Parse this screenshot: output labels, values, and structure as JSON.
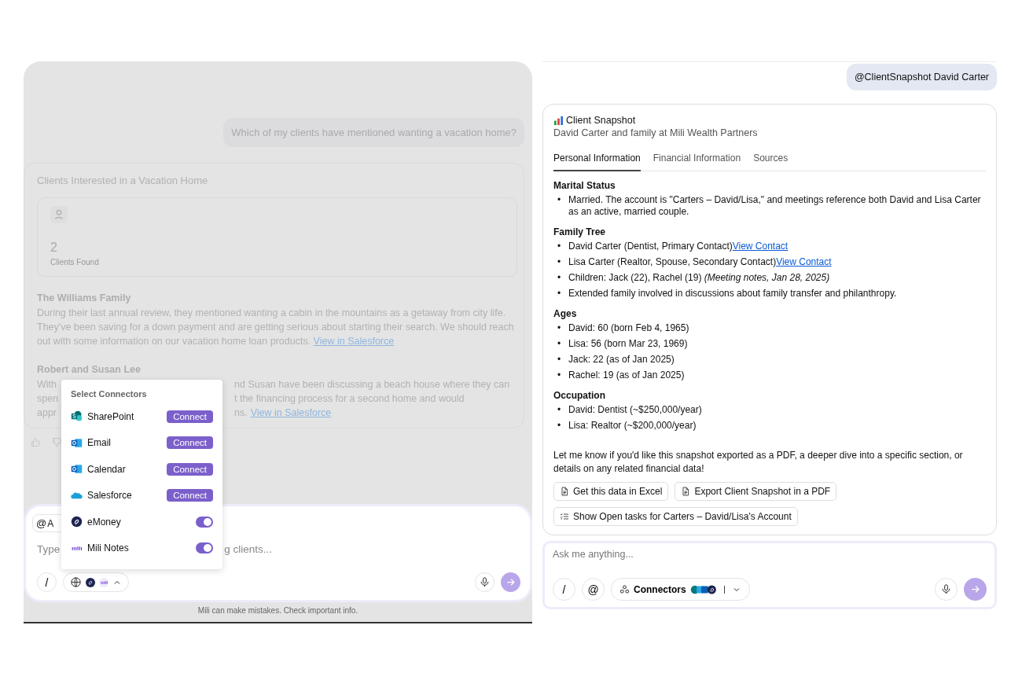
{
  "left_chat": {
    "user_message": "Which of my clients have mentioned wanting a vacation home?",
    "result_card": {
      "title": "Clients Interested in a Vacation Home",
      "stat_value": "2",
      "stat_label": "Clients Found",
      "clients": [
        {
          "kind": "full",
          "name": "The Williams Family",
          "text": "During their last annual review, they mentioned wanting a cabin in the mountains as a getaway from city life. They've been saving for a down payment and are getting serious about starting their search. We should reach out with some information on our vacation home loan products.",
          "link": "View in Salesforce"
        },
        {
          "kind": "covered",
          "name": "Robert and Susan Lee",
          "lines": [
            {
              "before": "With",
              "after": "nd Susan have been discussing a beach house where they can"
            },
            {
              "before": "spen",
              "after": "t the financing process for a second home and would"
            },
            {
              "before": "appr",
              "after": "ns."
            }
          ],
          "link": "View in Salesforce"
        }
      ]
    },
    "composer": {
      "mention_symbol": "@",
      "mention_label": "A",
      "placeholder_before": "Type",
      "placeholder_after": "g clients...",
      "slash": "/",
      "footnote": "Mili can make mistakes. Check important info."
    },
    "connectors_menu": {
      "title": "Select Connectors",
      "items": [
        {
          "name": "SharePoint",
          "kind": "connect",
          "action": "Connect"
        },
        {
          "name": "Email",
          "kind": "connect",
          "action": "Connect"
        },
        {
          "name": "Calendar",
          "kind": "connect",
          "action": "Connect"
        },
        {
          "name": "Salesforce",
          "kind": "connect",
          "action": "Connect"
        },
        {
          "name": "eMoney",
          "kind": "toggle",
          "on": true
        },
        {
          "name": "Mili Notes",
          "kind": "toggle",
          "on": true
        }
      ]
    }
  },
  "right_chat": {
    "user_message": "@ClientSnapshot David Carter",
    "snapshot": {
      "title": "Client Snapshot",
      "subtitle": "David Carter and family at Mili Wealth Partners",
      "tabs": [
        {
          "label": "Personal Information",
          "selected": true
        },
        {
          "label": "Financial Information",
          "selected": false
        },
        {
          "label": "Sources",
          "selected": false
        }
      ],
      "sections": [
        {
          "heading": "Marital Status",
          "items": [
            {
              "marker": "•",
              "text": "Married. The account is \"Carters – David/Lisa,\" and meetings reference both David and Lisa Carter as an active, married couple."
            }
          ]
        },
        {
          "heading": "Family Tree",
          "items": [
            {
              "marker": "•",
              "text": "David Carter (Dentist, Primary Contact)",
              "link": "View Contact"
            },
            {
              "marker": "•",
              "text": "Lisa Carter (Realtor, Spouse, Secondary Contact)",
              "link": "View Contact"
            },
            {
              "marker": "•",
              "text": "Children: Jack (22), Rachel (19) *(Meeting notes, Jan 28, 2025)*"
            },
            {
              "marker": "•",
              "text": "Extended family involved in discussions about family transfer and philanthropy."
            }
          ]
        },
        {
          "heading": "Ages",
          "items": [
            {
              "marker": "•",
              "text": "David: 60 (born Feb 4, 1965)"
            },
            {
              "marker": "•",
              "text": "Lisa: 56 (born Mar 23, 1969)"
            },
            {
              "marker": "•",
              "text": "Jack: 22 (as of Jan 2025)"
            },
            {
              "marker": "•",
              "text": "Rachel: 19 (as of Jan 2025)"
            }
          ]
        },
        {
          "heading": "Occupation",
          "items": [
            {
              "marker": "•",
              "text": "David: Dentist (~$250,000/year)"
            },
            {
              "marker": "•",
              "text": "Lisa: Realtor (~$200,000/year)"
            }
          ]
        }
      ],
      "closing": "Let me know if you'd like this snapshot exported as a PDF, a deeper dive into a specific section, or details on any related financial data!",
      "actions": [
        "Get this data in Excel",
        "Export Client Snapshot in a PDF",
        "Show Open tasks for Carters – David/Lisa's Account"
      ]
    },
    "composer": {
      "placeholder": "Ask me anything...",
      "slash": "/",
      "at": "@",
      "connectors_label": "Connectors"
    }
  }
}
